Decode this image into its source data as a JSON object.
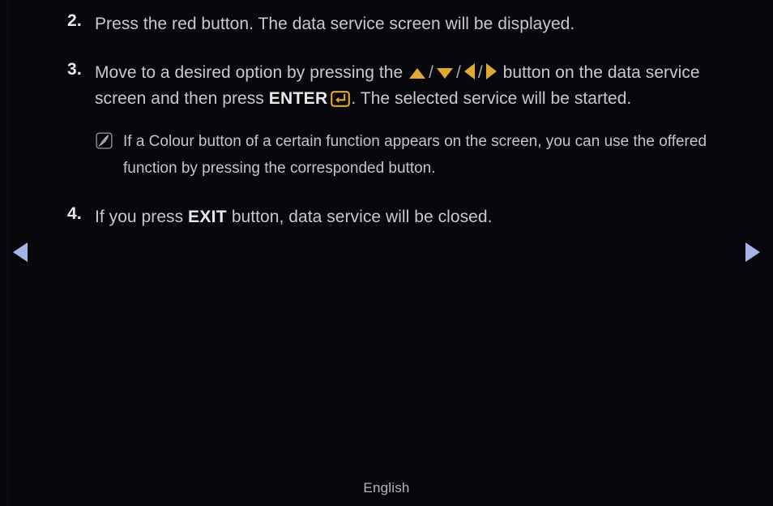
{
  "page": {
    "background_color": "#08080c",
    "body_text_color": "#c9c9cc",
    "accent_gold": "#e0a92e",
    "nav_arrow_color": "#a5b4e8"
  },
  "steps": [
    {
      "number": "2.",
      "text": "Press the red button. The data service screen will be displayed."
    },
    {
      "number": "3.",
      "text_before_arrows": "Move to a desired option by pressing the ",
      "separator": "/",
      "text_after_arrows": " button on the data service screen and then press ",
      "enter_label": "ENTER",
      "text_after_enter": ". The selected service will be started.",
      "arrows": [
        "up-arrow",
        "down-arrow",
        "left-arrow",
        "right-arrow"
      ],
      "enter_icon": "enter-return-icon"
    },
    {
      "number": "4.",
      "text_before_bold": "If you press ",
      "bold_label": "EXIT",
      "text_after_bold": " button, data service will be closed."
    }
  ],
  "note": {
    "icon": "note-pencil-icon",
    "text": "If a Colour button of a certain function appears on the screen, you can use the offered function by pressing the corresponded button."
  },
  "navigation": {
    "prev_icon": "previous-page-arrow-icon",
    "next_icon": "next-page-arrow-icon"
  },
  "footer": {
    "language": "English"
  }
}
